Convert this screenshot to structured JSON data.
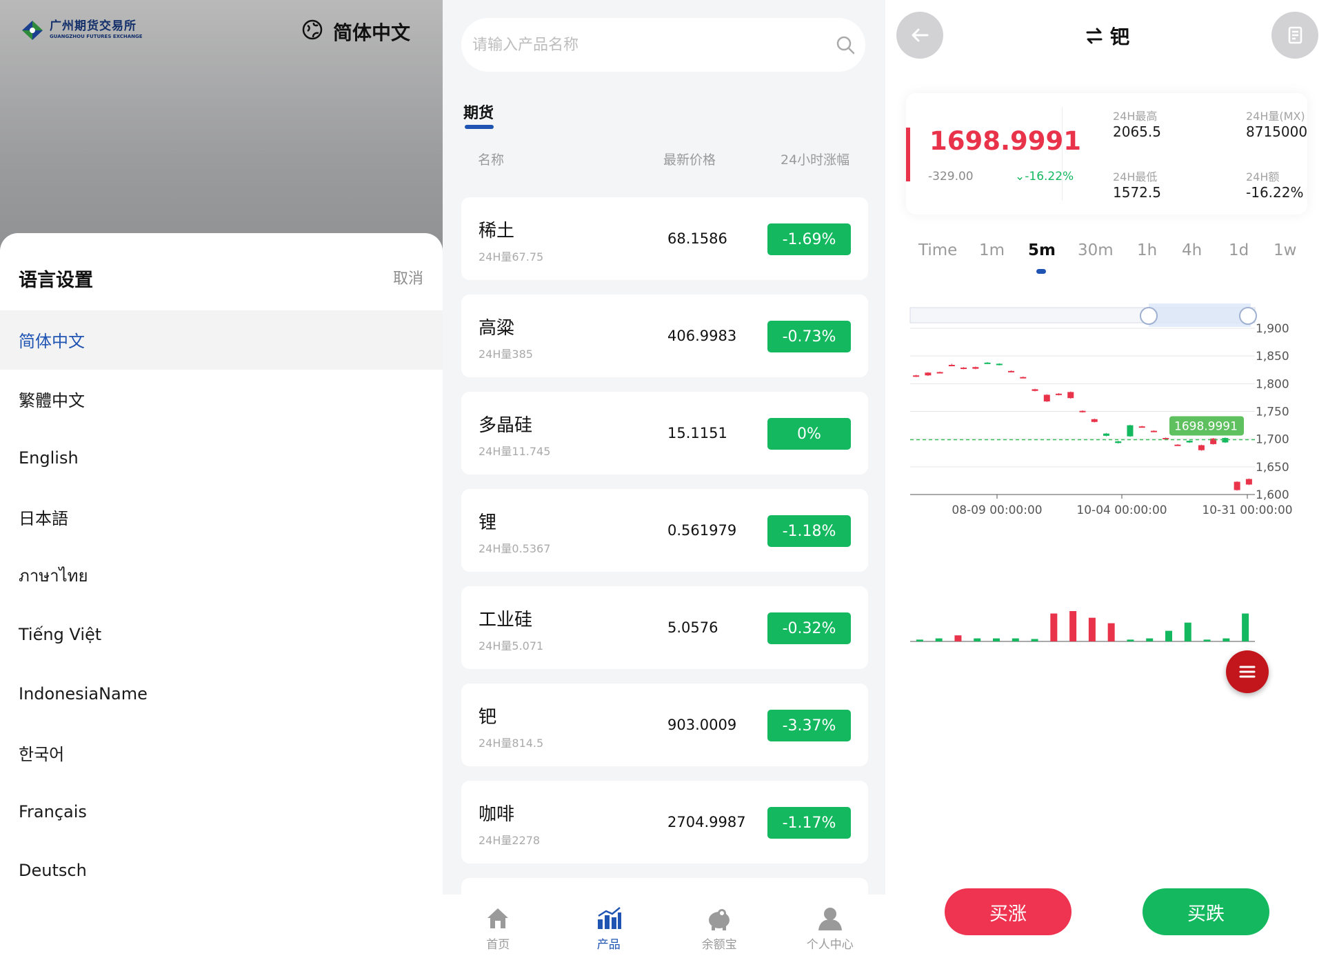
{
  "p1": {
    "logo_cn": "广州期货交易所",
    "logo_en": "GUANGZHOU FUTURES EXCHANGE",
    "current_lang": "简体中文",
    "sheet_title": "语言设置",
    "cancel": "取消",
    "languages": [
      "简体中文",
      "繁體中文",
      "English",
      "日本語",
      "ภาษาไทย",
      "Tiếng Việt",
      "IndonesiaName",
      "한국어",
      "Français",
      "Deutsch"
    ]
  },
  "p2": {
    "search_placeholder": "请输入产品名称",
    "tab": "期货",
    "headers": {
      "name": "名称",
      "price": "最新价格",
      "change": "24小时涨幅"
    },
    "products": [
      {
        "name": "稀土",
        "volume": "24H量67.75",
        "price": "68.1586",
        "change": "-1.69%"
      },
      {
        "name": "高粱",
        "volume": "24H量385",
        "price": "406.9983",
        "change": "-0.73%"
      },
      {
        "name": "多晶硅",
        "volume": "24H量11.745",
        "price": "15.1151",
        "change": "0%"
      },
      {
        "name": "锂",
        "volume": "24H量0.5367",
        "price": "0.561979",
        "change": "-1.18%"
      },
      {
        "name": "工业硅",
        "volume": "24H量5.071",
        "price": "5.0576",
        "change": "-0.32%"
      },
      {
        "name": "钯",
        "volume": "24H量814.5",
        "price": "903.0009",
        "change": "-3.37%"
      },
      {
        "name": "咖啡",
        "volume": "24H量2278",
        "price": "2704.9987",
        "change": "-1.17%"
      }
    ],
    "nav": [
      "首页",
      "产品",
      "余额宝",
      "个人中心"
    ],
    "colors": {
      "accent": "#1f54b3",
      "up": "#14b85f"
    }
  },
  "p3": {
    "title": "钯",
    "last_price": "1698.9991",
    "diff": "-329.00",
    "pct": "-16.22%",
    "stats": {
      "high_label": "24H最高",
      "high": "2065.5",
      "vol_label": "24H量(MX)",
      "vol": "8715000",
      "low_label": "24H最低",
      "low": "1572.5",
      "amt_label": "24H额",
      "amt": "-16.22%"
    },
    "timeframes": [
      "Time",
      "1m",
      "5m",
      "30m",
      "1h",
      "4h",
      "1d",
      "1w"
    ],
    "active_timeframe": "5m",
    "buy_up": "买涨",
    "buy_down": "买跌",
    "colors": {
      "up": "#14b85f",
      "down": "#e8334a"
    }
  },
  "chart_data": {
    "type": "candlestick",
    "y_ticks": [
      "1,900",
      "1,850",
      "1,800",
      "1,750",
      "1,700",
      "1,650",
      "1,600"
    ],
    "ylim": [
      1600,
      1900
    ],
    "x_ticks": [
      "08-09 00:00:00",
      "10-04 00:00:00",
      "10-31 00:00:00"
    ],
    "last_price_label": "1698.9991",
    "last_price": 1698.9991,
    "candles": [
      {
        "o": 1815,
        "c": 1813,
        "h": 1816,
        "l": 1812
      },
      {
        "o": 1820,
        "c": 1815,
        "h": 1821,
        "l": 1814
      },
      {
        "o": 1821,
        "c": 1820,
        "h": 1822,
        "l": 1819
      },
      {
        "o": 1834,
        "c": 1833,
        "h": 1836,
        "l": 1832
      },
      {
        "o": 1829,
        "c": 1827,
        "h": 1830,
        "l": 1826
      },
      {
        "o": 1830,
        "c": 1827,
        "h": 1831,
        "l": 1826
      },
      {
        "o": 1837,
        "c": 1838,
        "h": 1839,
        "l": 1836
      },
      {
        "o": 1834,
        "c": 1836,
        "h": 1837,
        "l": 1833
      },
      {
        "o": 1823,
        "c": 1822,
        "h": 1824,
        "l": 1821
      },
      {
        "o": 1812,
        "c": 1811,
        "h": 1813,
        "l": 1810
      },
      {
        "o": 1790,
        "c": 1787,
        "h": 1791,
        "l": 1786
      },
      {
        "o": 1780,
        "c": 1768,
        "h": 1781,
        "l": 1767
      },
      {
        "o": 1782,
        "c": 1780,
        "h": 1783,
        "l": 1779
      },
      {
        "o": 1785,
        "c": 1774,
        "h": 1786,
        "l": 1773
      },
      {
        "o": 1751,
        "c": 1749,
        "h": 1752,
        "l": 1748
      },
      {
        "o": 1736,
        "c": 1731,
        "h": 1737,
        "l": 1730
      },
      {
        "o": 1706,
        "c": 1710,
        "h": 1711,
        "l": 1705
      },
      {
        "o": 1693,
        "c": 1696,
        "h": 1697,
        "l": 1692
      },
      {
        "o": 1705,
        "c": 1725,
        "h": 1726,
        "l": 1704
      },
      {
        "o": 1723,
        "c": 1722,
        "h": 1724,
        "l": 1721
      },
      {
        "o": 1715,
        "c": 1714,
        "h": 1716,
        "l": 1713
      },
      {
        "o": 1702,
        "c": 1700,
        "h": 1703,
        "l": 1699
      },
      {
        "o": 1690,
        "c": 1689,
        "h": 1691,
        "l": 1688
      },
      {
        "o": 1694,
        "c": 1697,
        "h": 1698,
        "l": 1693
      },
      {
        "o": 1689,
        "c": 1680,
        "h": 1690,
        "l": 1679
      },
      {
        "o": 1701,
        "c": 1691,
        "h": 1702,
        "l": 1690
      },
      {
        "o": 1694,
        "c": 1702,
        "h": 1703,
        "l": 1693
      },
      {
        "o": 1623,
        "c": 1608,
        "h": 1624,
        "l": 1607
      },
      {
        "o": 1628,
        "c": 1618,
        "h": 1629,
        "l": 1617
      }
    ],
    "volumes": [
      {
        "v": 0.06,
        "up": true
      },
      {
        "v": 0.1,
        "up": true
      },
      {
        "v": 0.2,
        "up": false
      },
      {
        "v": 0.1,
        "up": true
      },
      {
        "v": 0.1,
        "up": true
      },
      {
        "v": 0.1,
        "up": true
      },
      {
        "v": 0.08,
        "up": true
      },
      {
        "v": 0.92,
        "up": false
      },
      {
        "v": 1.0,
        "up": false
      },
      {
        "v": 0.78,
        "up": false
      },
      {
        "v": 0.6,
        "up": false
      },
      {
        "v": 0.06,
        "up": true
      },
      {
        "v": 0.1,
        "up": true
      },
      {
        "v": 0.35,
        "up": true
      },
      {
        "v": 0.62,
        "up": true
      },
      {
        "v": 0.06,
        "up": true
      },
      {
        "v": 0.1,
        "up": true
      },
      {
        "v": 0.92,
        "up": true
      }
    ]
  }
}
